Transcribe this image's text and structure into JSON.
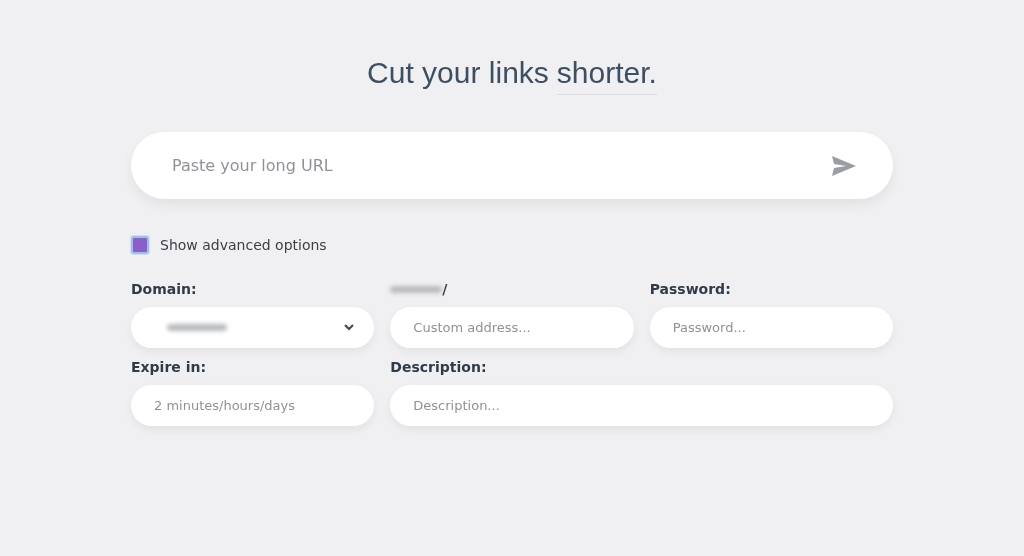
{
  "title": {
    "text": "Cut your links",
    "highlight": "shorter."
  },
  "url_field": {
    "placeholder": "Paste your long URL"
  },
  "advanced_options": {
    "label": "Show advanced options",
    "checked": true
  },
  "fields": [
    {
      "kind": "select",
      "label": "Domain:",
      "redacted_value": true
    },
    {
      "kind": "text",
      "label": "/",
      "redacted_label": true,
      "placeholder": "Custom address..."
    },
    {
      "kind": "text",
      "label": "Password:",
      "placeholder": "Password..."
    },
    {
      "kind": "text",
      "label": "Expire in:",
      "placeholder": "2 minutes/hours/days"
    },
    {
      "kind": "text",
      "label": "Description:",
      "placeholder": "Description...",
      "wide": true
    }
  ]
}
